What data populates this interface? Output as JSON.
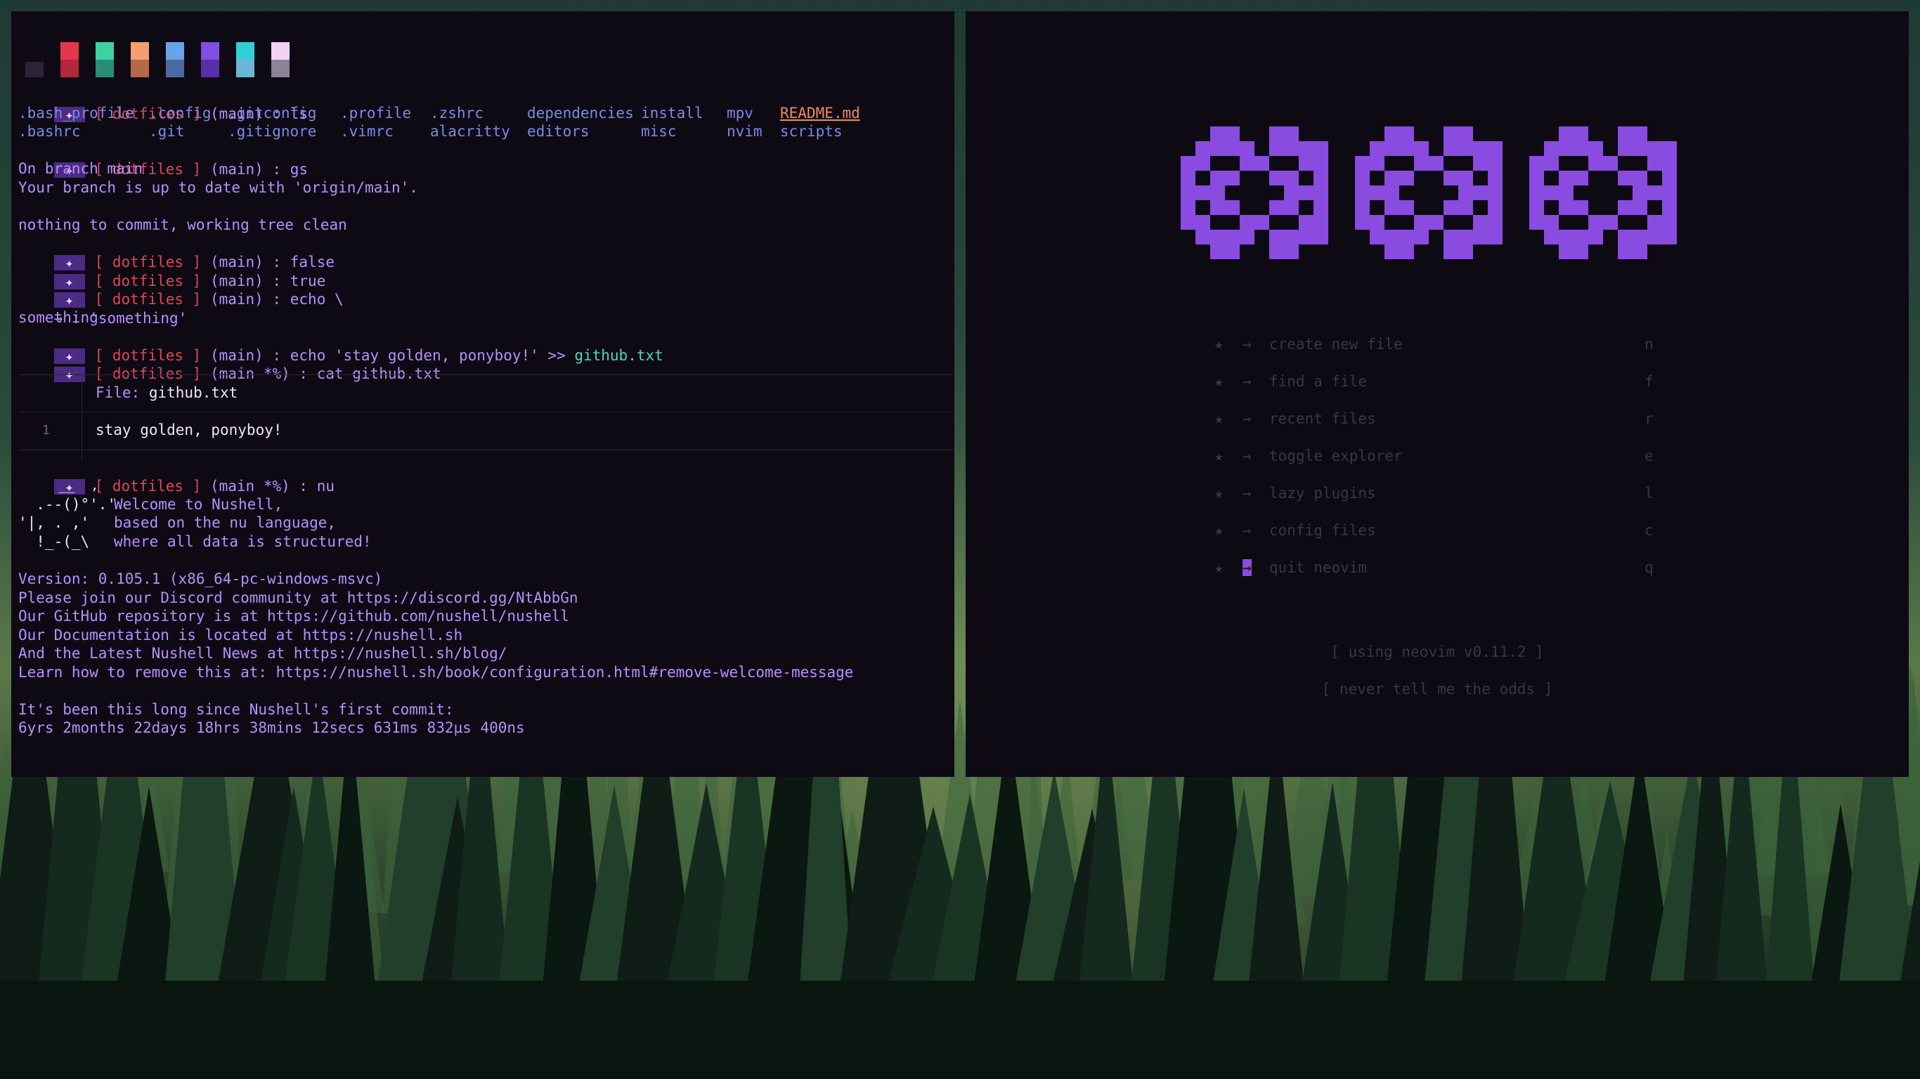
{
  "theme": {
    "accent": "#8a4be0",
    "badge": "#4b2b86",
    "prompt_red": "#e2445c",
    "text_purple": "#b690ff",
    "path_cyan": "#4fd6c8"
  },
  "swatches": [
    {
      "top": "#2b2336",
      "bottom": "#2b2336"
    },
    {
      "top": "#e5364f",
      "bottom": "#b3263c"
    },
    {
      "top": "#3fd2a0",
      "bottom": "#2b8c7a"
    },
    {
      "top": "#f2a070",
      "bottom": "#b5684a"
    },
    {
      "top": "#6ba3ea",
      "bottom": "#4d6aa0"
    },
    {
      "top": "#7f4ee3",
      "bottom": "#5a2ea6"
    },
    {
      "top": "#2fd0d8",
      "bottom": "#6ab6d6"
    },
    {
      "top": "#f1d2f4",
      "bottom": "#8d8298"
    }
  ],
  "terminal": {
    "prompt_glyph": "✦",
    "repo": "dotfiles",
    "branch_main": "(main)",
    "branch_dirty": "(main *%)",
    "commands": {
      "ls": "ls",
      "gs": "gs",
      "false": "false",
      "true": "true",
      "echo1": "echo \\",
      "echo_cont": "'something'",
      "echo2": "echo 'stay golden, ponyboy!' >> ",
      "echo2_file": "github.txt",
      "cat": "cat github.txt",
      "nu": "nu"
    },
    "ls_row1": [
      ".bash_profile",
      ".config",
      ".gitconfig",
      ".profile",
      ".zshrc",
      "dependencies",
      "install",
      "mpv",
      "README.md"
    ],
    "ls_row2": [
      ".bashrc",
      ".git",
      ".gitignore",
      ".vimrc",
      "alacritty",
      "editors",
      "misc",
      "nvim",
      "scripts"
    ],
    "git_status": [
      "On branch main",
      "Your branch is up to date with 'origin/main'.",
      "",
      "nothing to commit, working tree clean"
    ],
    "cont_prompt": "→ :",
    "echo_output": "something",
    "bat": {
      "header": "File: github.txt",
      "line_no": "1",
      "content": "stay golden, ponyboy!"
    },
    "nu_ascii": [
      "     __  ,",
      "  .--()°'.'",
      "'|, . ,'  ",
      "  !_-(_\\   "
    ],
    "nu_welcome": [
      "Welcome to Nushell,",
      "based on the nu language,",
      "where all data is structured!"
    ],
    "nu_info": [
      "Version: 0.105.1 (x86_64-pc-windows-msvc)",
      "Please join our Discord community at https://discord.gg/NtAbbGn",
      "Our GitHub repository is at https://github.com/nushell/nushell",
      "Our Documentation is located at https://nushell.sh",
      "And the Latest Nushell News at https://nushell.sh/blog/",
      "Learn how to remove this at: https://nushell.sh/book/configuration.html#remove-welcome-message",
      "",
      "It's been this long since Nushell's first commit:",
      "6yrs 2months 22days 18hrs 38mins 12secs 631ms 832µs 400ns"
    ]
  },
  "nvim": {
    "logo_color": "#8a4be0",
    "menu": [
      {
        "label": "create new file",
        "key": "n"
      },
      {
        "label": "find a file",
        "key": "f"
      },
      {
        "label": "recent files",
        "key": "r"
      },
      {
        "label": "toggle explorer",
        "key": "e"
      },
      {
        "label": "lazy plugins",
        "key": "l"
      },
      {
        "label": "config files",
        "key": "c"
      },
      {
        "label": "quit neovim",
        "key": "q"
      }
    ],
    "star": "★",
    "arrow": "→",
    "version": "[ using neovim v0.11.2 ]",
    "motto": "[ never tell me the odds ]"
  }
}
